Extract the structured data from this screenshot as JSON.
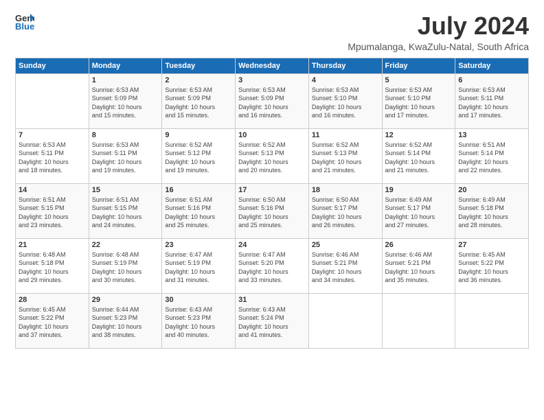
{
  "logo": {
    "line1": "General",
    "line2": "Blue"
  },
  "title": "July 2024",
  "location": "Mpumalanga, KwaZulu-Natal, South Africa",
  "days_of_week": [
    "Sunday",
    "Monday",
    "Tuesday",
    "Wednesday",
    "Thursday",
    "Friday",
    "Saturday"
  ],
  "weeks": [
    [
      {
        "day": "",
        "content": ""
      },
      {
        "day": "1",
        "content": "Sunrise: 6:53 AM\nSunset: 5:09 PM\nDaylight: 10 hours\nand 15 minutes."
      },
      {
        "day": "2",
        "content": "Sunrise: 6:53 AM\nSunset: 5:09 PM\nDaylight: 10 hours\nand 15 minutes."
      },
      {
        "day": "3",
        "content": "Sunrise: 6:53 AM\nSunset: 5:09 PM\nDaylight: 10 hours\nand 16 minutes."
      },
      {
        "day": "4",
        "content": "Sunrise: 6:53 AM\nSunset: 5:10 PM\nDaylight: 10 hours\nand 16 minutes."
      },
      {
        "day": "5",
        "content": "Sunrise: 6:53 AM\nSunset: 5:10 PM\nDaylight: 10 hours\nand 17 minutes."
      },
      {
        "day": "6",
        "content": "Sunrise: 6:53 AM\nSunset: 5:11 PM\nDaylight: 10 hours\nand 17 minutes."
      }
    ],
    [
      {
        "day": "7",
        "content": "Sunrise: 6:53 AM\nSunset: 5:11 PM\nDaylight: 10 hours\nand 18 minutes."
      },
      {
        "day": "8",
        "content": "Sunrise: 6:53 AM\nSunset: 5:11 PM\nDaylight: 10 hours\nand 19 minutes."
      },
      {
        "day": "9",
        "content": "Sunrise: 6:52 AM\nSunset: 5:12 PM\nDaylight: 10 hours\nand 19 minutes."
      },
      {
        "day": "10",
        "content": "Sunrise: 6:52 AM\nSunset: 5:13 PM\nDaylight: 10 hours\nand 20 minutes."
      },
      {
        "day": "11",
        "content": "Sunrise: 6:52 AM\nSunset: 5:13 PM\nDaylight: 10 hours\nand 21 minutes."
      },
      {
        "day": "12",
        "content": "Sunrise: 6:52 AM\nSunset: 5:14 PM\nDaylight: 10 hours\nand 21 minutes."
      },
      {
        "day": "13",
        "content": "Sunrise: 6:51 AM\nSunset: 5:14 PM\nDaylight: 10 hours\nand 22 minutes."
      }
    ],
    [
      {
        "day": "14",
        "content": "Sunrise: 6:51 AM\nSunset: 5:15 PM\nDaylight: 10 hours\nand 23 minutes."
      },
      {
        "day": "15",
        "content": "Sunrise: 6:51 AM\nSunset: 5:15 PM\nDaylight: 10 hours\nand 24 minutes."
      },
      {
        "day": "16",
        "content": "Sunrise: 6:51 AM\nSunset: 5:16 PM\nDaylight: 10 hours\nand 25 minutes."
      },
      {
        "day": "17",
        "content": "Sunrise: 6:50 AM\nSunset: 5:16 PM\nDaylight: 10 hours\nand 25 minutes."
      },
      {
        "day": "18",
        "content": "Sunrise: 6:50 AM\nSunset: 5:17 PM\nDaylight: 10 hours\nand 26 minutes."
      },
      {
        "day": "19",
        "content": "Sunrise: 6:49 AM\nSunset: 5:17 PM\nDaylight: 10 hours\nand 27 minutes."
      },
      {
        "day": "20",
        "content": "Sunrise: 6:49 AM\nSunset: 5:18 PM\nDaylight: 10 hours\nand 28 minutes."
      }
    ],
    [
      {
        "day": "21",
        "content": "Sunrise: 6:48 AM\nSunset: 5:18 PM\nDaylight: 10 hours\nand 29 minutes."
      },
      {
        "day": "22",
        "content": "Sunrise: 6:48 AM\nSunset: 5:19 PM\nDaylight: 10 hours\nand 30 minutes."
      },
      {
        "day": "23",
        "content": "Sunrise: 6:47 AM\nSunset: 5:19 PM\nDaylight: 10 hours\nand 31 minutes."
      },
      {
        "day": "24",
        "content": "Sunrise: 6:47 AM\nSunset: 5:20 PM\nDaylight: 10 hours\nand 33 minutes."
      },
      {
        "day": "25",
        "content": "Sunrise: 6:46 AM\nSunset: 5:21 PM\nDaylight: 10 hours\nand 34 minutes."
      },
      {
        "day": "26",
        "content": "Sunrise: 6:46 AM\nSunset: 5:21 PM\nDaylight: 10 hours\nand 35 minutes."
      },
      {
        "day": "27",
        "content": "Sunrise: 6:45 AM\nSunset: 5:22 PM\nDaylight: 10 hours\nand 36 minutes."
      }
    ],
    [
      {
        "day": "28",
        "content": "Sunrise: 6:45 AM\nSunset: 5:22 PM\nDaylight: 10 hours\nand 37 minutes."
      },
      {
        "day": "29",
        "content": "Sunrise: 6:44 AM\nSunset: 5:23 PM\nDaylight: 10 hours\nand 38 minutes."
      },
      {
        "day": "30",
        "content": "Sunrise: 6:43 AM\nSunset: 5:23 PM\nDaylight: 10 hours\nand 40 minutes."
      },
      {
        "day": "31",
        "content": "Sunrise: 6:43 AM\nSunset: 5:24 PM\nDaylight: 10 hours\nand 41 minutes."
      },
      {
        "day": "",
        "content": ""
      },
      {
        "day": "",
        "content": ""
      },
      {
        "day": "",
        "content": ""
      }
    ]
  ]
}
